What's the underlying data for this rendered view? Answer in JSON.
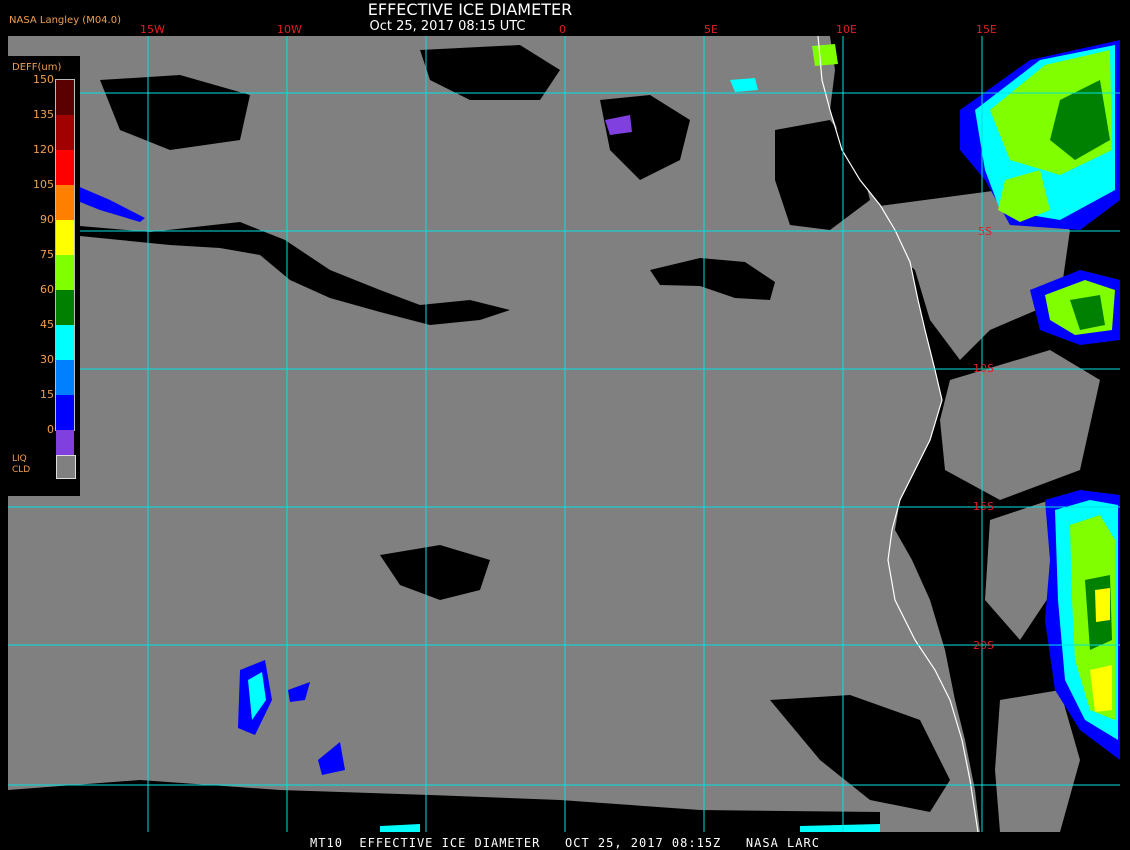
{
  "header": {
    "title": "EFFECTIVE ICE DIAMETER",
    "subtitle": "Oct 25, 2017 08:15 UTC",
    "source": "NASA Langley (M04.0)"
  },
  "legend": {
    "title": "DEFF(um)",
    "ticks": [
      "150",
      "135",
      "120",
      "105",
      "90",
      "75",
      "60",
      "45",
      "30",
      "15",
      "0"
    ],
    "colors": [
      "#5a0000",
      "#a00000",
      "#ff0000",
      "#ff8000",
      "#ffff00",
      "#80ff00",
      "#008000",
      "#00ffff",
      "#0080ff",
      "#0000ff",
      "#8040e0"
    ],
    "liq_label_1": "LIQ",
    "liq_label_2": "CLD",
    "liq_color": "#808080"
  },
  "map": {
    "lon_labels": [
      "15W",
      "10W",
      "0",
      "5E",
      "10E",
      "15E"
    ],
    "lat_labels": [
      "5S",
      "10S",
      "15S",
      "20S"
    ],
    "colors": {
      "ocean_cloud": "#808080",
      "clear": "#000000",
      "grid": "#00e0e0",
      "coast": "#ffffff",
      "grid_label": "#e02020"
    }
  },
  "footer": {
    "text": "MT10  EFFECTIVE ICE DIAMETER   OCT 25, 2017 08:15Z   NASA LARC"
  }
}
